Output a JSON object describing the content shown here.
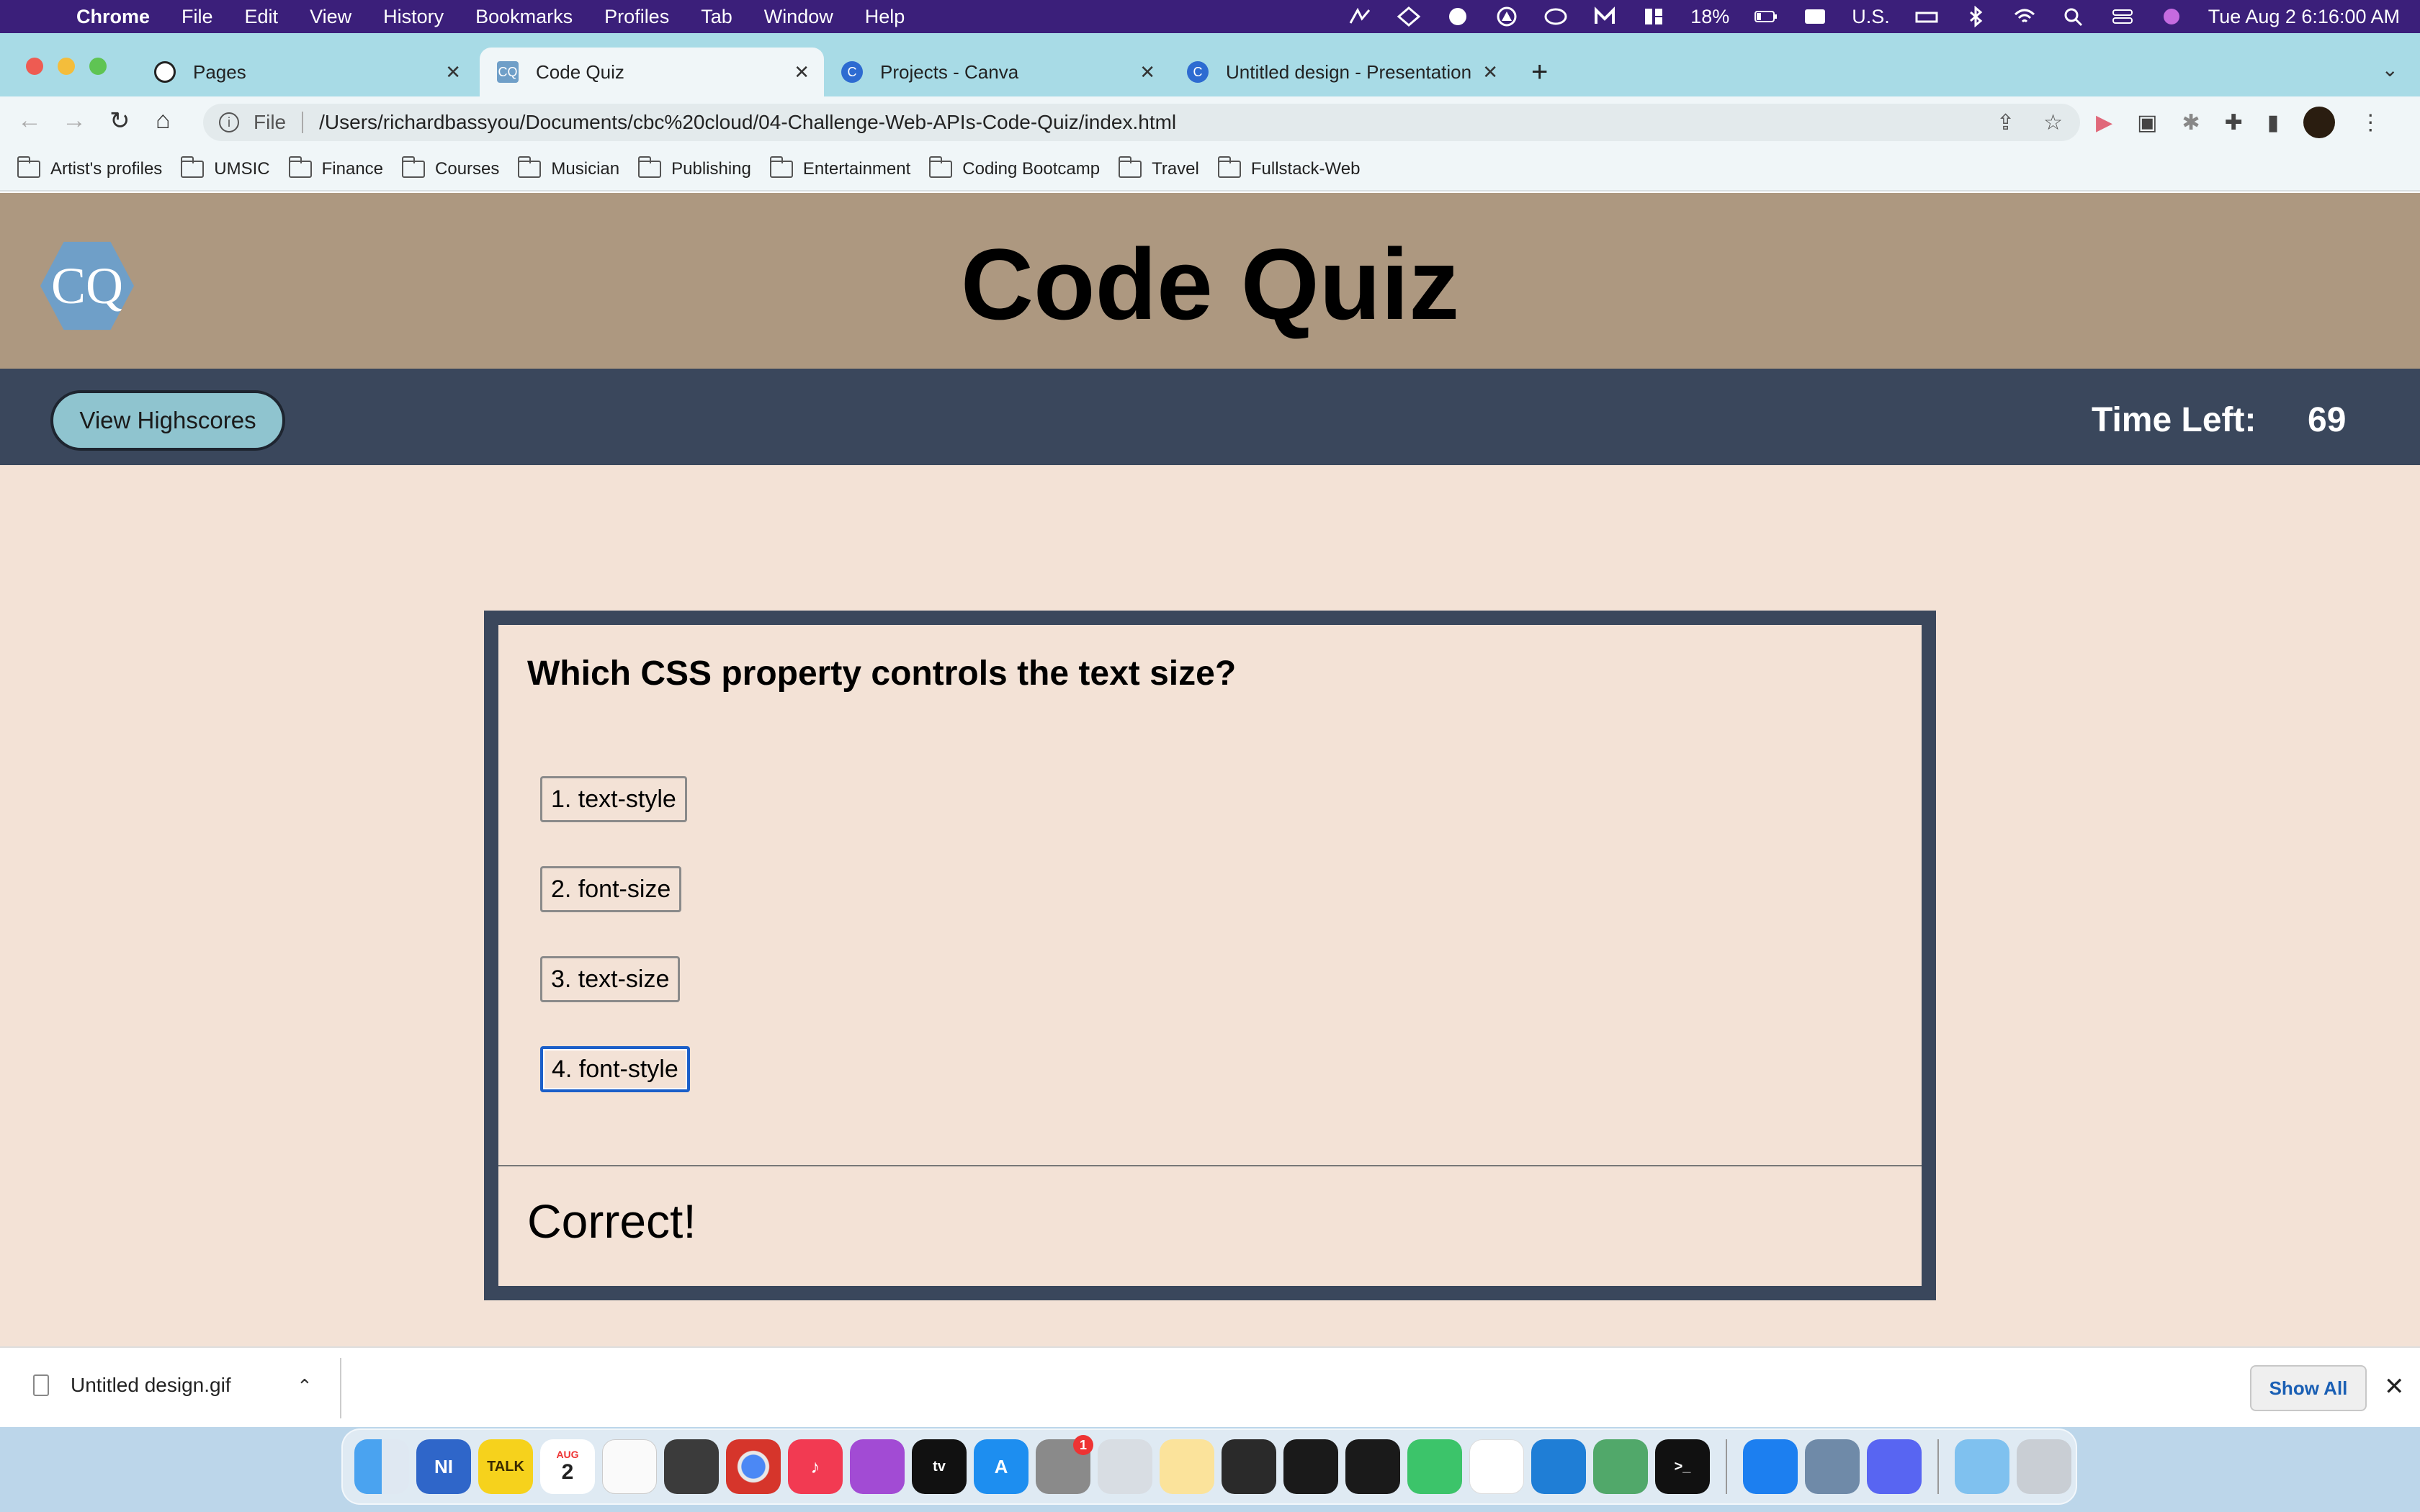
{
  "menubar": {
    "app": "Chrome",
    "items": [
      "File",
      "Edit",
      "View",
      "History",
      "Bookmarks",
      "Profiles",
      "Tab",
      "Window",
      "Help"
    ],
    "battery": "18%",
    "input_source": "U.S.",
    "clock": "Tue Aug 2  6:16:00 AM"
  },
  "tabs": [
    {
      "title": "Pages",
      "icon": "github-icon"
    },
    {
      "title": "Code Quiz",
      "icon": "cq-favicon"
    },
    {
      "title": "Projects - Canva",
      "icon": "canva-icon"
    },
    {
      "title": "Untitled design - Presentation",
      "icon": "canva-icon"
    }
  ],
  "omnibox": {
    "scheme": "File",
    "url": "/Users/richardbassyou/Documents/cbc%20cloud/04-Challenge-Web-APIs-Code-Quiz/index.html"
  },
  "bookmarks": [
    "Artist's profiles",
    "UMSIC",
    "Finance",
    "Courses",
    "Musician",
    "Publishing",
    "Entertainment",
    "Coding Bootcamp",
    "Travel",
    "Fullstack-Web"
  ],
  "site": {
    "logo": "CQ",
    "title": "Code Quiz",
    "highscores_label": "View Highscores",
    "time_label": "Time Left:",
    "time_value": "69"
  },
  "quiz": {
    "question": "Which CSS property controls the text size?",
    "answers": [
      "1. text-style",
      "2. font-size",
      "3. text-size",
      "4. font-style"
    ],
    "feedback": "Correct!"
  },
  "downloads": {
    "file": "Untitled design.gif",
    "show_all": "Show All"
  },
  "dock": {
    "calendar_month": "AUG",
    "calendar_day": "2",
    "talk_label": "TALK",
    "settings_badge": "1"
  },
  "colors": {
    "header": "#ad9880",
    "nav": "#3a475c",
    "page_bg": "#f3e2d6",
    "highscore_button": "#8fc4cf",
    "logo": "#6f9fc8",
    "tabstrip": "#a8dbe6"
  }
}
